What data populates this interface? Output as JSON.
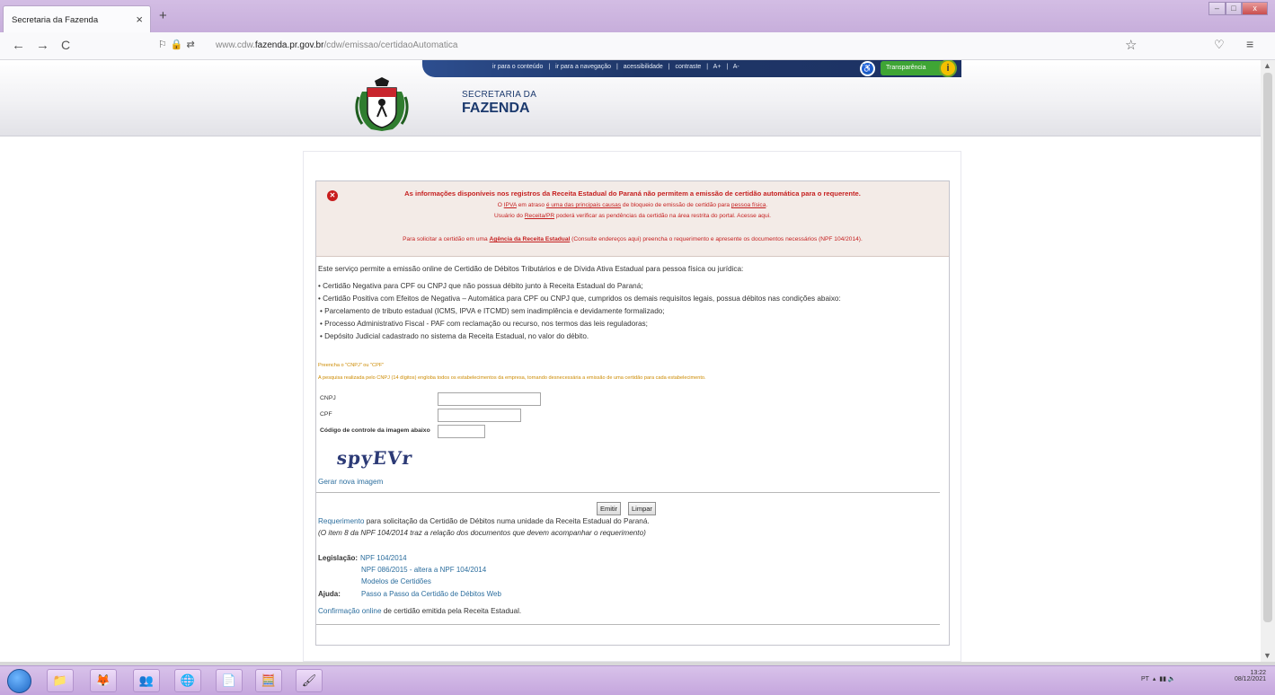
{
  "browser": {
    "tab_title": "Secretaria da Fazenda",
    "tab_close": "×",
    "new_tab": "+",
    "url_prefix": "www.cdw.",
    "url_domain": "fazenda.pr.gov.br",
    "url_path": "/cdw/emissao/certidaoAutomatica",
    "nav_back": "←",
    "nav_forward": "→",
    "nav_reload": "C",
    "star": "☆",
    "pocket": "♡",
    "menu": "≡"
  },
  "header": {
    "access_links": [
      "ir para o conteúdo",
      "|",
      "ir para a navegação",
      "|",
      "acessibilidade",
      "|",
      "contraste",
      "|",
      "A+",
      "|",
      "A-"
    ],
    "transparency_label": "Transparência",
    "info_icon_glyph": "i",
    "brand_top": "SECRETARIA DA",
    "brand_main": "FAZENDA"
  },
  "alert": {
    "icon": "✕",
    "line1": "As informações disponíveis nos registros da Receita Estadual do Paraná não permitem a emissão de certidão automática para o requerente.",
    "line2_a": "O ",
    "line2_link1": "IPVA",
    "line2_b": " em atraso ",
    "line2_link2": "é uma das principais causas",
    "line2_c": " de bloqueio de emissão de certidão para ",
    "line2_link3": "pessoa física",
    "line2_d": ".",
    "line3_a": "Usuário do ",
    "line3_link": "Receita/PR",
    "line3_b": " poderá verificar as pendências da certidão na área restrita do portal. Acesse aqui.",
    "line4_a": "Para solicitar a certidão em uma ",
    "line4_link": "Agência da Receita Estadual",
    "line4_b": " (Consulte endereços aqui) preencha o requerimento e apresente os documentos necessários (NPF 104/2014)."
  },
  "main": {
    "intro": "Este serviço permite a emissão online de Certidão de Débitos Tributários e de Dívida Ativa Estadual para pessoa física ou jurídica:",
    "bullets": [
      "• Certidão Negativa para CPF ou CNPJ que não possua débito junto à Receita Estadual do Paraná;",
      "• Certidão Positiva com Efeitos de Negativa – Automática para CPF ou CNPJ que, cumpridos os demais requisitos legais, possua débitos nas condições abaixo:",
      "  • Parcelamento de tributo estadual (ICMS, IPVA e ITCMD) sem inadimplência e devidamente formalizado;",
      "  • Processo Administrativo Fiscal - PAF com reclamação ou recurso, nos termos das leis reguladoras;",
      "  • Depósito Judicial cadastrado no sistema da Receita Estadual, no valor do débito."
    ],
    "hint1": "Preencha o \"CNPJ\" ou \"CPF\"",
    "hint2": "A pesquisa realizada pelo CNPJ (14 dígitos) engloba todos os estabelecimentos da empresa, tornando desnecessária a emissão de uma certidão para cada estabelecimento.",
    "form": {
      "cnpj_label": "CNPJ",
      "cpf_label": "CPF",
      "code_label": "Código de controle da imagem abaixo",
      "cnpj_value": "",
      "cpf_value": "",
      "code_value": ""
    },
    "captcha_text": "spyEVr",
    "new_image_link": "Gerar nova imagem",
    "emit_button": "Emitir",
    "clear_button": "Limpar",
    "requirement_a": "Requerimento",
    "requirement_b": " para solicitação da Certidão de Débitos numa unidade da Receita Estadual do Paraná.",
    "requirement_note": "(O item 8 da NPF 104/2014 traz a relação dos documentos que devem acompanhar o requerimento)",
    "legislation_label": "Legislação:",
    "legislation_links": [
      "NPF 104/2014",
      "NPF 086/2015 - altera a NPF 104/2014",
      "Modelos de Certidões"
    ],
    "help_label": "Ajuda:",
    "help_link": "Passo a Passo da Certidão de Débitos Web",
    "confirmation_a": "Confirmação online",
    "confirmation_b": " de certidão emitida pela Receita Estadual."
  },
  "taskbar": {
    "apps": [
      "📁",
      "🦊",
      "👥",
      "🌐",
      "📄",
      "🧮",
      "🖌"
    ],
    "language": "PT",
    "time": "13:22",
    "date": "08/12/2021"
  }
}
